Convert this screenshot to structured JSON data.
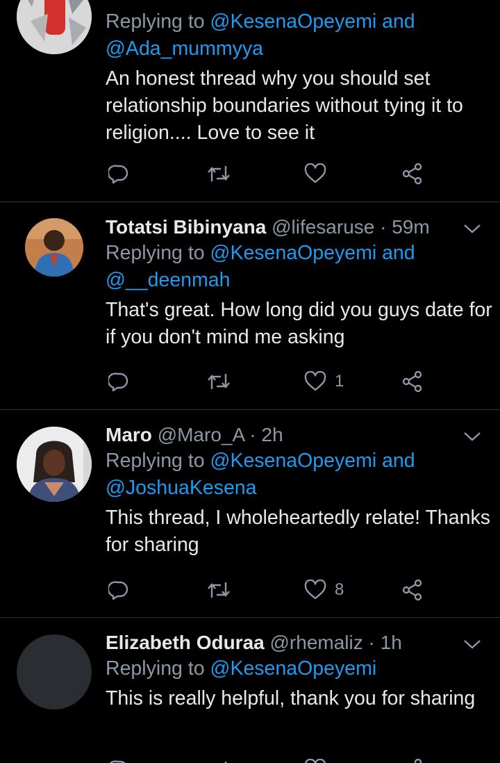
{
  "tweets": [
    {
      "name": "",
      "handle": "",
      "time": "",
      "replying_prefix": "Replying to",
      "replying_mention1": "@KesenaOpeyemi",
      "replying_and": "and",
      "replying_mention2": "@Ada_mummyya",
      "text": "An honest thread why you should set relationship boundaries without tying it to religion.... Love to see it",
      "likes": ""
    },
    {
      "name": "Totatsi Bibinyana",
      "handle": "@lifesaruse",
      "time": "· 59m",
      "replying_prefix": "Replying to",
      "replying_mention1": "@KesenaOpeyemi",
      "replying_and": "and",
      "replying_mention2": "@__deenmah",
      "text": "That's great. How long did you guys date for if you don't mind me asking",
      "likes": "1"
    },
    {
      "name": "Maro",
      "handle": "@Maro_A",
      "time": "· 2h",
      "replying_prefix": "Replying to",
      "replying_mention1": "@KesenaOpeyemi",
      "replying_and": "and",
      "replying_mention2": "@JoshuaKesena",
      "text": "This thread, I wholeheartedly relate! Thanks for sharing",
      "likes": "8"
    },
    {
      "name": "Elizabeth Oduraa",
      "handle": "@rhemaliz",
      "time": "· 1h",
      "replying_prefix": "Replying to",
      "replying_mention1": "@KesenaOpeyemi",
      "text": "This is really helpful, thank you for sharing"
    }
  ],
  "colors": {
    "background": "#000000",
    "accent": "#1d9bf0",
    "muted": "#8b98a5",
    "divider": "#2f3336"
  },
  "icons": [
    "reply-icon",
    "retweet-icon",
    "like-icon",
    "share-icon",
    "chevron-down-icon"
  ]
}
